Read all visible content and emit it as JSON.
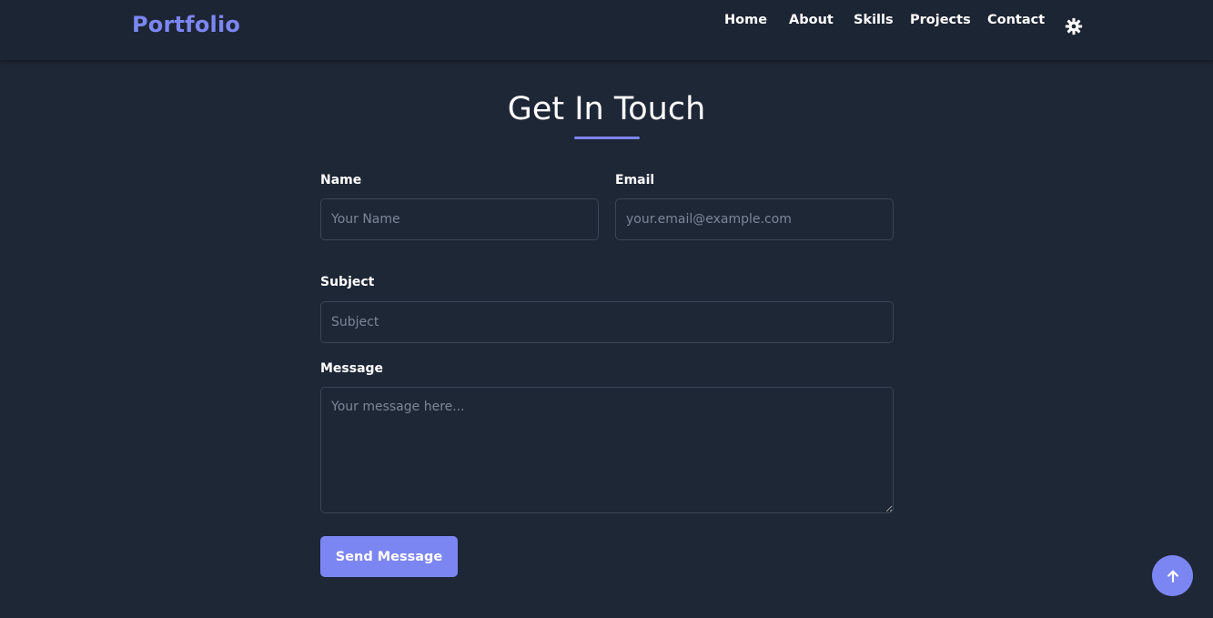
{
  "navbar": {
    "logo": "Portfolio",
    "links": [
      "Home",
      "About",
      "Skills",
      "Projects",
      "Contact"
    ],
    "theme_icon": "gear-icon"
  },
  "contact": {
    "title": "Get In Touch",
    "name_label": "Name",
    "name_placeholder": "Your Name",
    "email_label": "Email",
    "email_placeholder": "your.email@example.com",
    "subject_label": "Subject",
    "subject_placeholder": "Subject",
    "message_label": "Message",
    "message_placeholder": "Your message here...",
    "submit_label": "Send Message"
  },
  "scroll_top_icon": "arrow-up-icon",
  "colors": {
    "background": "#1e2736",
    "accent": "#7c86f2",
    "text": "#ffffff",
    "border": "#3a4557"
  }
}
